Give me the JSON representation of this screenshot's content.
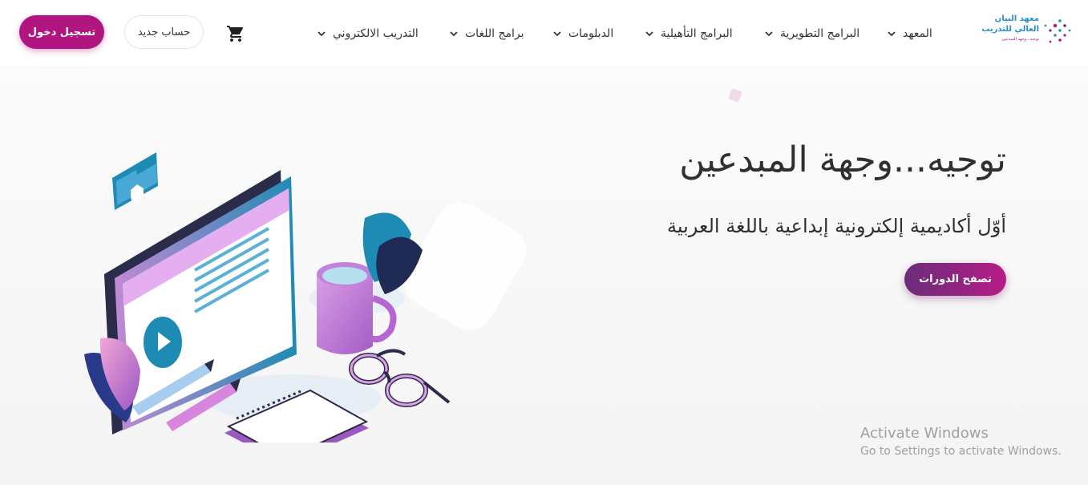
{
  "header": {
    "login_label": "تسجيل دخول",
    "signup_label": "حساب جديد",
    "cart_icon": "cart-icon",
    "nav": [
      {
        "label": "المعهد"
      },
      {
        "label": "البرامج التطويرية"
      },
      {
        "label": "البرامج التأهيلية"
      },
      {
        "label": "الدبلومات"
      },
      {
        "label": "برامج اللغات"
      },
      {
        "label": "التدريب الالكتروني"
      }
    ],
    "logo": {
      "line1": "معهد البيان",
      "line2": "العالي للتدريب",
      "tagline": "توجيه...وجهة المبدعين"
    }
  },
  "hero": {
    "title": "توجيه...وجهة المبدعين",
    "subtitle": "أوّل أكاديمية إلكترونية إبداعية باللغة العربية",
    "cta_label": "تصفح الدورات"
  },
  "watermark": {
    "line1": "Activate Windows",
    "line2": "Go to Settings to activate Windows."
  },
  "colors": {
    "brand": "#b1157f",
    "cta_start": "#6b2c7a",
    "cta_end": "#b51d85"
  }
}
